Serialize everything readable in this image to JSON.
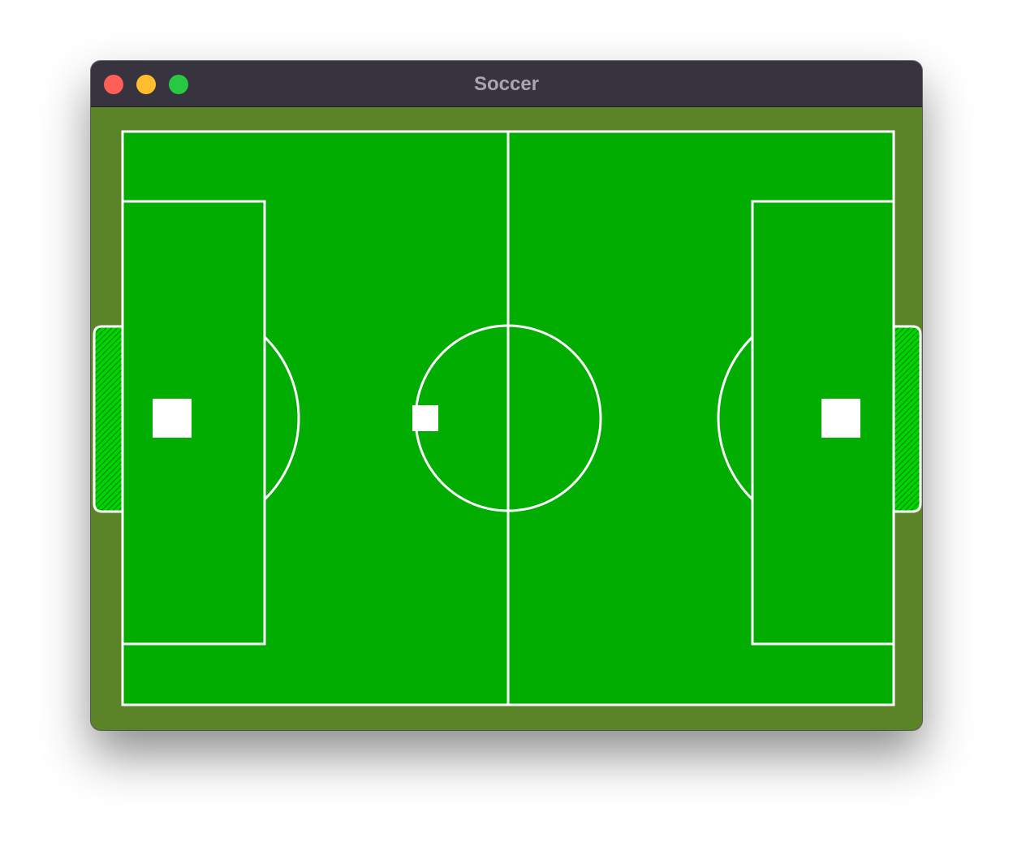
{
  "window": {
    "title": "Soccer"
  },
  "colors": {
    "surround": "#5a8427",
    "pitch": "#00ad00",
    "lines": "#ffffff",
    "titlebar": "#37343f",
    "title_text": "#a9a6b0",
    "goal_net": "#00d400"
  },
  "controls": {
    "close": "close-button",
    "minimize": "minimize-button",
    "zoom": "zoom-button"
  }
}
